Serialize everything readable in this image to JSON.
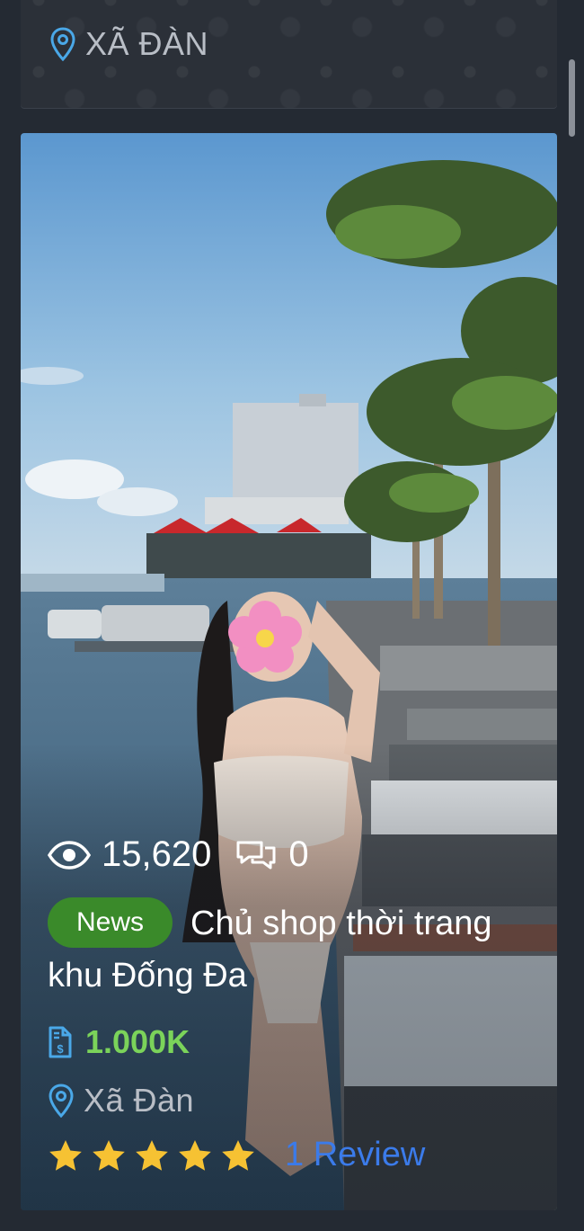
{
  "top_card": {
    "location": "XÃ ĐÀN"
  },
  "post": {
    "views": "15,620",
    "comments": "0",
    "badge": "News",
    "title": "Chủ shop thời trang khu Đống Đa",
    "price": "1.000K",
    "location": "Xã Đàn",
    "stars": 5,
    "reviews": "1 Review"
  },
  "colors": {
    "background": "#242a33",
    "badge": "#3a8a2a",
    "price": "#7bd35a",
    "review_link": "#3b7bea",
    "star": "#f6c233",
    "icon": "#4aa8e8"
  }
}
